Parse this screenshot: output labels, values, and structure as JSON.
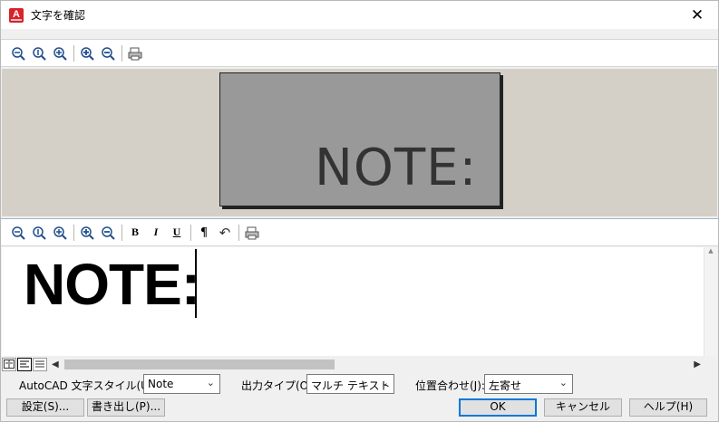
{
  "window": {
    "title": "文字を確認",
    "close_label": "✕"
  },
  "toolbar_top": {
    "icons": [
      "zoom-out-icon",
      "zoom-extents-icon",
      "zoom-in-icon",
      "zoom-in-plus-icon",
      "zoom-out-minus-icon",
      "print-preview-icon"
    ]
  },
  "preview": {
    "text": "NOTE:",
    "card_color": "#999999",
    "background": "#d4d0c8"
  },
  "toolbar_mid": {
    "bold": "B",
    "italic": "I",
    "underline": "U",
    "paragraph": "¶",
    "undo": "↶"
  },
  "editor": {
    "text": "NOTE:"
  },
  "options": {
    "style_label": "AutoCAD 文字スタイル(U):",
    "style_value": "Note",
    "output_label": "出力タイプ(O):",
    "output_value": "マルチ テキスト",
    "align_label": "位置合わせ(J):",
    "align_value": "左寄せ"
  },
  "buttons": {
    "settings": "設定(S)...",
    "export": "書き出し(P)...",
    "ok": "OK",
    "cancel": "キャンセル",
    "help": "ヘルプ(H)"
  },
  "colors": {
    "accent": "#0078d7",
    "app_icon": "#d8232a"
  }
}
